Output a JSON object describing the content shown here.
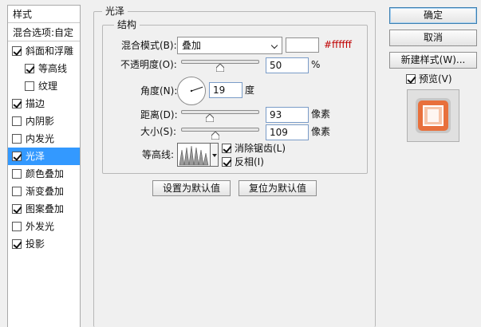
{
  "style_list": {
    "header": "样式",
    "blending_options": "混合选项:自定",
    "items": [
      {
        "label": "斜面和浮雕",
        "checked": true,
        "indent": false,
        "selected": false
      },
      {
        "label": "等高线",
        "checked": true,
        "indent": true,
        "selected": false
      },
      {
        "label": "纹理",
        "checked": false,
        "indent": true,
        "selected": false
      },
      {
        "label": "描边",
        "checked": true,
        "indent": false,
        "selected": false
      },
      {
        "label": "内阴影",
        "checked": false,
        "indent": false,
        "selected": false
      },
      {
        "label": "内发光",
        "checked": false,
        "indent": false,
        "selected": false
      },
      {
        "label": "光泽",
        "checked": true,
        "indent": false,
        "selected": true
      },
      {
        "label": "颜色叠加",
        "checked": false,
        "indent": false,
        "selected": false
      },
      {
        "label": "渐变叠加",
        "checked": false,
        "indent": false,
        "selected": false
      },
      {
        "label": "图案叠加",
        "checked": true,
        "indent": false,
        "selected": false
      },
      {
        "label": "外发光",
        "checked": false,
        "indent": false,
        "selected": false
      },
      {
        "label": "投影",
        "checked": true,
        "indent": false,
        "selected": false
      }
    ]
  },
  "panel": {
    "title": "光泽",
    "structure_title": "结构",
    "blend_mode_label": "混合模式(B):",
    "blend_mode_value": "叠加",
    "color_hex": "#ffffff",
    "opacity_label": "不透明度(O):",
    "opacity_value": "50",
    "opacity_unit": "%",
    "opacity_level": 0.5,
    "angle_label": "角度(N):",
    "angle_value": "19",
    "angle_unit": "度",
    "angle_degrees": 19,
    "distance_label": "距离(D):",
    "distance_value": "93",
    "distance_unit": "像素",
    "distance_level": 0.37,
    "size_label": "大小(S):",
    "size_value": "109",
    "size_unit": "像素",
    "size_level": 0.44,
    "contour_label": "等高线:",
    "anti_alias_label": "消除锯齿(L)",
    "anti_alias_checked": true,
    "invert_label": "反相(I)",
    "invert_checked": true,
    "make_default_label": "设置为默认值",
    "reset_default_label": "复位为默认值"
  },
  "right": {
    "ok_label": "确定",
    "cancel_label": "取消",
    "new_style_label": "新建样式(W)...",
    "preview_label": "预览(V)",
    "preview_checked": true
  },
  "colors": {
    "selection": "#3399ff",
    "hex_text": "#c00000",
    "preview_orange": "#e8703c"
  }
}
